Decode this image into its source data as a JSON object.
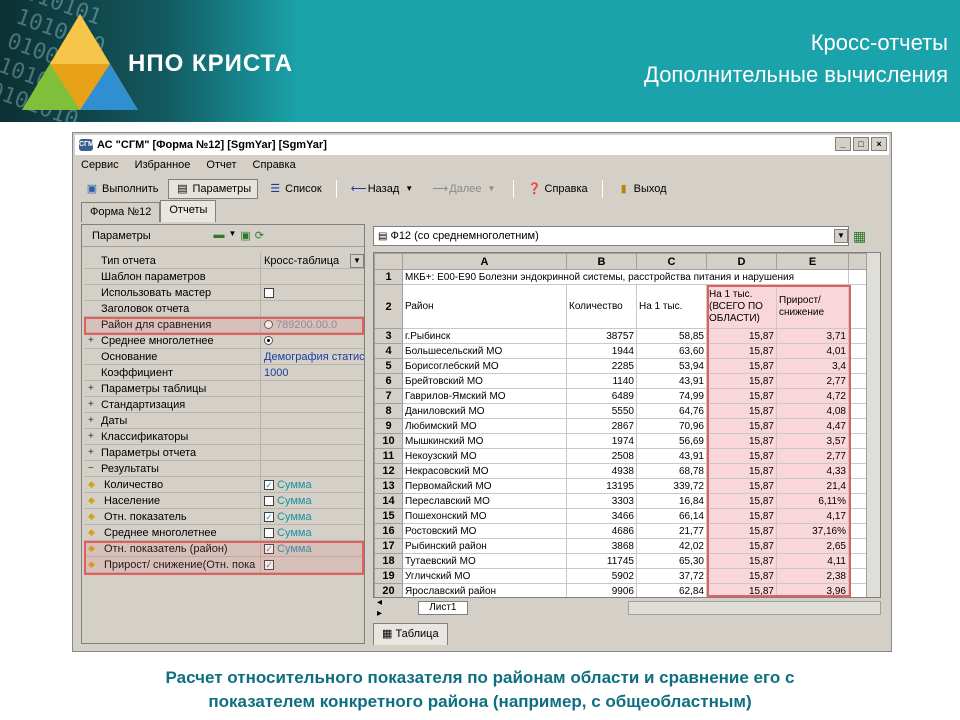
{
  "header": {
    "brand": "НПО КРИСТА",
    "title_line1": "Кросс-отчеты",
    "title_line2": "Дополнительные вычисления",
    "binary_text": "010101\n1010110\n01001010\n10101101\n0101010"
  },
  "window": {
    "app_icon": "СГМ",
    "title": "АС \"СГМ\" [Форма №12] [SgmYar] [SgmYar]",
    "buttons": [
      "_",
      "□",
      "×"
    ],
    "menu": [
      "Сервис",
      "Избранное",
      "Отчет",
      "Справка"
    ],
    "toolbar": {
      "run": "Выполнить",
      "params": "Параметры",
      "list": "Список",
      "back": "Назад",
      "forward": "Далее",
      "help": "Справка",
      "exit": "Выход"
    },
    "tabs": [
      "Форма №12",
      "Отчеты"
    ]
  },
  "left_panel": {
    "header": "Параметры",
    "rows": [
      {
        "name": "Тип отчета",
        "value": "Кросс-таблица",
        "kind": "dropdown"
      },
      {
        "name": "Шаблон параметров",
        "value": "",
        "kind": "text"
      },
      {
        "name": "Использовать мастер",
        "value": "",
        "kind": "checkbox"
      },
      {
        "name": "Заголовок отчета",
        "value": "",
        "kind": "text"
      },
      {
        "name": "Район для сравнения",
        "value": "789200.00.0",
        "kind": "radio-off"
      },
      {
        "name": "Среднее многолетнее",
        "value": "",
        "kind": "radio-on"
      },
      {
        "name": "Основание",
        "value": "Демография статис",
        "kind": "text"
      },
      {
        "name": "Коэффициент",
        "value": "1000",
        "kind": "text"
      },
      {
        "name": "Параметры таблицы",
        "value": "",
        "kind": "group"
      },
      {
        "name": "Стандартизация",
        "value": "",
        "kind": "group"
      },
      {
        "name": "Даты",
        "value": "",
        "kind": "group"
      },
      {
        "name": "Классификаторы",
        "value": "",
        "kind": "group"
      },
      {
        "name": "Параметры отчета",
        "value": "",
        "kind": "group"
      },
      {
        "name": "Результаты",
        "value": "",
        "kind": "group-open"
      },
      {
        "name": "Количество",
        "value": "Сумма",
        "kind": "result-on"
      },
      {
        "name": "Население",
        "value": "Сумма",
        "kind": "result-off"
      },
      {
        "name": "Отн. показатель",
        "value": "Сумма",
        "kind": "result-on"
      },
      {
        "name": "Среднее многолетнее",
        "value": "Сумма",
        "kind": "result-off"
      },
      {
        "name": "Отн. показатель (район)",
        "value": "Сумма",
        "kind": "result-on"
      },
      {
        "name": "Прирост/ снижение(Отн. пока",
        "value": "",
        "kind": "result-on"
      }
    ]
  },
  "right_panel": {
    "report_select": "Ф12 (со среднемноголетним)",
    "columns": [
      "A",
      "B",
      "C",
      "D",
      "E"
    ],
    "row1": "МКБ+: Е00-Е90 Болезни эндокринной системы, расстройства питания и нарушения",
    "header_row": [
      "Район",
      "Количество",
      "На 1 тыс.",
      "На 1 тыс. (ВСЕГО ПО ОБЛАСТИ)",
      "Прирост/снижение"
    ],
    "rows": [
      [
        "г.Рыбинск",
        "38757",
        "58,85",
        "15,87",
        "3,71"
      ],
      [
        "Большесельский МО",
        "1944",
        "63,60",
        "15,87",
        "4,01"
      ],
      [
        "Борисоглебский МО",
        "2285",
        "53,94",
        "15,87",
        "3,4"
      ],
      [
        "Брейтовский МО",
        "1140",
        "43,91",
        "15,87",
        "2,77"
      ],
      [
        "Гаврилов-Ямский МО",
        "6489",
        "74,99",
        "15,87",
        "4,72"
      ],
      [
        "Даниловский МО",
        "5550",
        "64,76",
        "15,87",
        "4,08"
      ],
      [
        "Любимский МО",
        "2867",
        "70,96",
        "15,87",
        "4,47"
      ],
      [
        "Мышкинский МО",
        "1974",
        "56,69",
        "15,87",
        "3,57"
      ],
      [
        "Некоузский МО",
        "2508",
        "43,91",
        "15,87",
        "2,77"
      ],
      [
        "Некрасовский МО",
        "4938",
        "68,78",
        "15,87",
        "4,33"
      ],
      [
        "Первомайский МО",
        "13195",
        "339,72",
        "15,87",
        "21,4"
      ],
      [
        "Переславский МО",
        "3303",
        "16,84",
        "15,87",
        "6,11%"
      ],
      [
        "Пошехонский МО",
        "3466",
        "66,14",
        "15,87",
        "4,17"
      ],
      [
        "Ростовский МО",
        "4686",
        "21,77",
        "15,87",
        "37,16%"
      ],
      [
        "Рыбинский район",
        "3868",
        "42,02",
        "15,87",
        "2,65"
      ],
      [
        "Тутаевский МО",
        "11745",
        "65,30",
        "15,87",
        "4,11"
      ],
      [
        "Угличский МО",
        "5902",
        "37,72",
        "15,87",
        "2,38"
      ],
      [
        "Ярославский район",
        "9906",
        "62,84",
        "15,87",
        "3,96"
      ]
    ],
    "sheet_tab": "Лист1",
    "bottom_tab": "Таблица"
  },
  "caption": {
    "line1": "Расчет относительного показателя по районам области и сравнение его с",
    "line2": "показателем конкретного района (например, с общеобластным)"
  },
  "colors": {
    "banner": "#1aa3ab",
    "caption": "#0e6f80",
    "highlight": "#e06060",
    "pink_cell": "#f9d6da"
  }
}
